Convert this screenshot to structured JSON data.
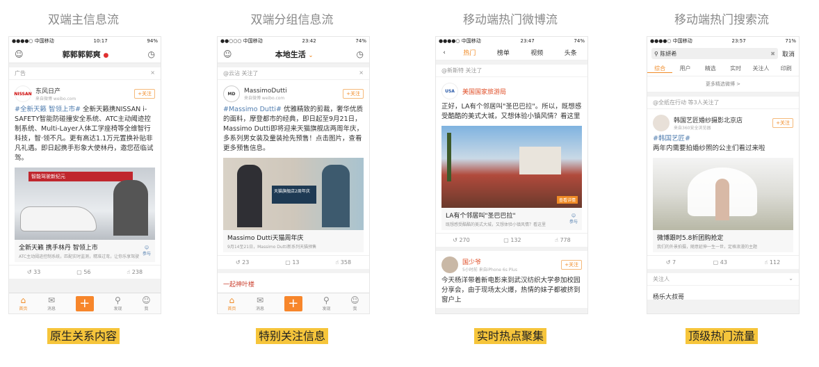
{
  "columns": [
    {
      "title": "双端主信息流",
      "caption": "原生关系内容"
    },
    {
      "title": "双端分组信息流",
      "caption": "特别关注信息"
    },
    {
      "title": "移动端热门微博流",
      "caption": "实时热点聚集"
    },
    {
      "title": "移动端热门搜索流",
      "caption": "顶级热门流量"
    }
  ],
  "phone1": {
    "status_left": "●●●●○ 中国移动",
    "status_time": "10:17",
    "status_right": "94%",
    "nav_title": "郭郭郭郭爽",
    "ad_label": "广告",
    "author": "东风日产",
    "author_sub": "来自微博 weibo.com",
    "follow": "+关注",
    "text_topic": "#全新天籁 智领上市#",
    "text_body": " 全新天籁携NISSAN i-SAFETY智能防碰撞安全系统、ATC主动阈迹控制系统、Multi-Layer人体工学座椅等全维智行科技，智·领不凡。更有高达1.1万元置换补贴非凡礼遇。即日起携手形象大使林丹，邀您莅临试驾。",
    "img_text": "智能驾驶新纪元",
    "link_title": "全新天籁 携手林丹 智领上市",
    "link_sub": "ATC主动阈迹控制系统，匹配实时监测，精准过弯，让你乐享驾驶",
    "link_icon_label": "参与",
    "repost": "33",
    "comment": "56",
    "like": "238",
    "tabs": [
      "首页",
      "消息",
      "",
      "发现",
      "我"
    ]
  },
  "phone2": {
    "status_left": "●●○○○ 中国移动",
    "status_time": "23:42",
    "status_right": "74%",
    "nav_title": "本地生活",
    "followed_by": "@云沾 关注了",
    "author": "MassimoDutti",
    "author_sub": "来自微博 weibo.com",
    "follow": "+关注",
    "text_topic": "#Massimo Dutti#",
    "text_body": " 优雅精致的剪裁，奢华优质的面料，摩登都市的经典，即日起至9月21日，Massimo Dutti即将迎来天猫旗舰店两周年庆，多系列男女装及童装抢先预售！点击图片，查看更多预售信息。",
    "img_text": "天猫旗舰店2周年庆",
    "link_title": "Massimo Dutti天猫周年庆",
    "link_sub": "9月14至21日，Massimo Dutti新系列天猫预售",
    "repost": "23",
    "comment": "13",
    "like": "358",
    "next_post": "一起神叶楼",
    "tabs": [
      "首页",
      "消息",
      "",
      "发现",
      "我"
    ]
  },
  "phone3": {
    "status_left": "●●●●○ 中国移动",
    "status_time": "23:47",
    "status_right": "74%",
    "tabs": [
      "热门",
      "榜单",
      "视频",
      "头条"
    ],
    "followed_by": "@新斯特 关注了",
    "author": "美国国家旅游局",
    "author_sub": "",
    "text_body": "正好，LA有个邻居叫\"圣巴巴拉\"。所以，既想感受酷酷的美式大城，又想体验小镇风情？看这里",
    "img_text": "查看详情",
    "link_title": "LA有个邻居叫\"圣巴巴拉\"",
    "link_sub": "既想感受酷酷的美式大城，又想体验小镇风情？看这里",
    "link_icon_label": "参与",
    "repost": "270",
    "comment": "132",
    "like": "778",
    "author2": "国少爷",
    "author2_sub": "5小时前 来自iPhone 6s Plus",
    "follow": "+关注",
    "text2": "今天杨洋带着新电影来到武汉纺织大学参加校园分享会，由于现场太火爆，热情的妹子都被挤到窗户上"
  },
  "phone4": {
    "status_left": "●●●●○ 中国移动",
    "status_time": "23:57",
    "status_right": "71%",
    "search_value": "陈妍希",
    "cancel": "取消",
    "subtabs": [
      "综合",
      "用户",
      "精选",
      "实时",
      "关注人",
      "印刷"
    ],
    "more_label": "更多精选微博 >",
    "followed_by": "@全纸在行动 等3人关注了",
    "author": "韩国艺匠婚纱摄影北京店",
    "author_sub": "来自360安全浏览器",
    "follow": "+关注",
    "text_topic": "#韩国艺匠#",
    "text_body": "两年内需要拍婚纱照的公主们看过来啦",
    "link_title": "微博跟时5.8折团购抢定",
    "link_sub": "我们的外景拍摄，随意延伸一生一世，定格浪漫的主题",
    "repost": "7",
    "comment": "43",
    "like": "112",
    "footer_label": "关注人",
    "next_author": "杨乐大叔哥"
  },
  "colors": {
    "accent": "#f08a24",
    "caption_bg": "#f6c53b",
    "topic": "#507daf"
  }
}
